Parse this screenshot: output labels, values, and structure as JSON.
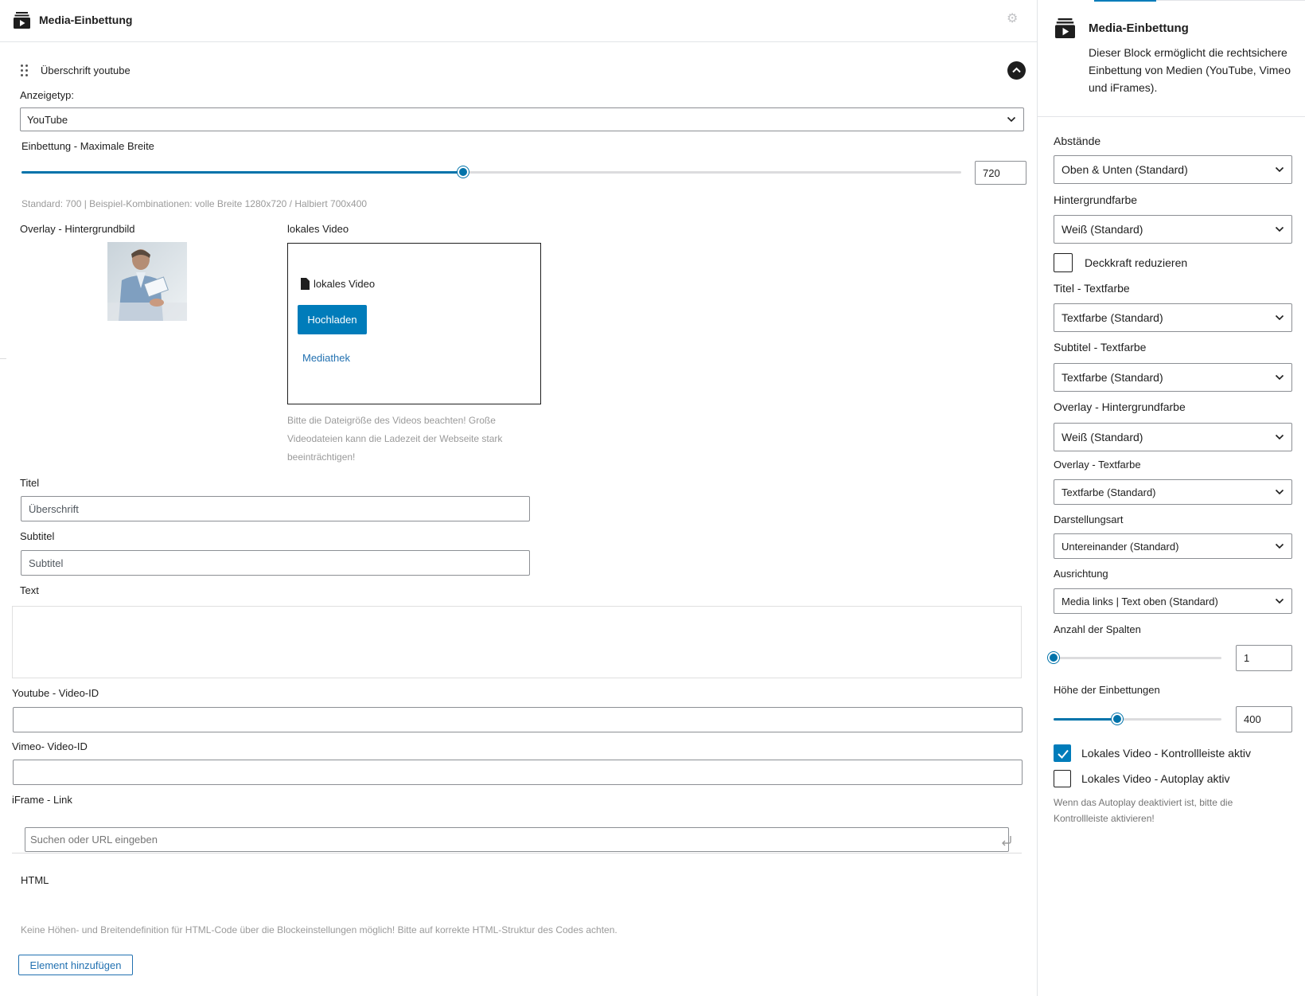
{
  "editor": {
    "block_title": "Media-Einbettung",
    "item_title": "Überschrift youtube",
    "display_type": {
      "label": "Anzeigetyp:",
      "value": "YouTube"
    },
    "max_width": {
      "label": "Einbettung - Maximale Breite",
      "value": "720",
      "fraction": 0.47,
      "hint": "Standard: 700 | Beispiel-Kombinationen: volle Breite 1280x720 / Halbiert 700x400"
    },
    "overlay_label": "Overlay - Hintergrundbild",
    "local_video": {
      "label": "lokales Video",
      "box_title": "lokales Video",
      "upload_button": "Hochladen",
      "media_link": "Mediathek",
      "hint": "Bitte die Dateigröße des Videos beachten! Große Videodateien kann die Ladezeit der Webseite stark beeinträchtigen!"
    },
    "title_field": {
      "label": "Titel",
      "value": "Überschrift"
    },
    "subtitle_field": {
      "label": "Subtitel",
      "value": "Subtitel"
    },
    "text_label": "Text",
    "youtube_id_label": "Youtube - Video-ID",
    "vimeo_id_label": "Vimeo- Video-ID",
    "iframe": {
      "label": "iFrame - Link",
      "placeholder": "Suchen oder URL eingeben"
    },
    "html_label": "HTML",
    "html_hint": "Keine Höhen- und Breitendefinition für HTML-Code über die Blockeinstellungen möglich! Bitte auf korrekte HTML-Struktur des Codes achten.",
    "add_button": "Element hinzufügen"
  },
  "sidebar": {
    "title": "Media-Einbettung",
    "description": "Dieser Block ermöglicht die rechtsichere Einbettung von Medien (YouTube, Vimeo und iFrames).",
    "fields": [
      {
        "label": "Abstände",
        "value": "Oben & Unten (Standard)"
      },
      {
        "label": "Hintergrundfarbe",
        "value": "Weiß (Standard)"
      },
      {
        "label": "Titel - Textfarbe",
        "value": "Textfarbe (Standard)"
      },
      {
        "label": "Subtitel - Textfarbe",
        "value": "Textfarbe (Standard)"
      },
      {
        "label": "Overlay - Hintergrundfarbe",
        "value": "Weiß (Standard)"
      },
      {
        "label": "Overlay - Textfarbe",
        "value": "Textfarbe (Standard)"
      },
      {
        "label": "Darstellungsart",
        "value": "Untereinander (Standard)"
      },
      {
        "label": "Ausrichtung",
        "value": "Media links | Text oben (Standard)"
      }
    ],
    "reduce_opacity": {
      "label": "Deckkraft reduzieren",
      "checked": false
    },
    "columns": {
      "label": "Anzahl der Spalten",
      "value": "1",
      "fraction": 0.0
    },
    "embed_height": {
      "label": "Höhe der Einbettungen",
      "value": "400",
      "fraction": 0.38
    },
    "controls_active": {
      "label": "Lokales Video - Kontrollleiste aktiv",
      "checked": true
    },
    "autoplay_active": {
      "label": "Lokales Video - Autoplay aktiv",
      "checked": false
    },
    "hint": "Wenn das Autoplay deaktiviert ist, bitte die Kontrollleiste aktivieren!"
  },
  "colors": {
    "accent": "#007cba",
    "link": "#2271b1",
    "text": "#1e1e1e",
    "hint": "#9a9a9a"
  }
}
